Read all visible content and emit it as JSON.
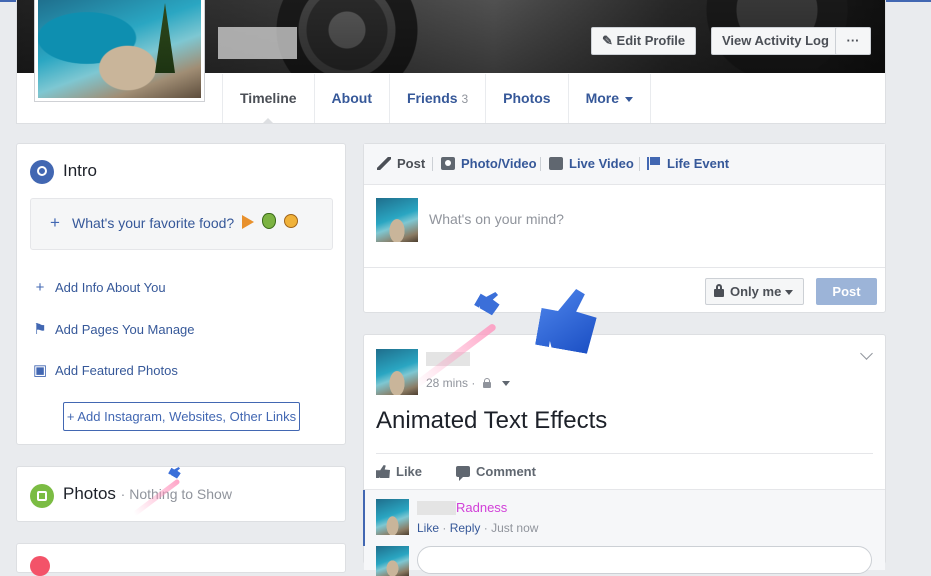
{
  "profile_header": {
    "buttons": {
      "edit_profile": "Edit Profile",
      "view_activity_log": "View Activity Log",
      "more": "···"
    },
    "tabs": [
      {
        "label": "Timeline"
      },
      {
        "label": "About"
      },
      {
        "label": "Friends",
        "count": "3"
      },
      {
        "label": "Photos"
      },
      {
        "label": "More"
      }
    ]
  },
  "intro": {
    "title": "Intro",
    "favorite_food_prompt": "What's your favorite food?",
    "links": [
      {
        "label": "Add Info About You",
        "icon": "plus-icon"
      },
      {
        "label": "Add Pages You Manage",
        "icon": "flag-icon"
      },
      {
        "label": "Add Featured Photos",
        "icon": "photo-add-icon"
      }
    ],
    "links_button": "Add Instagram, Websites, Other Links"
  },
  "photos_card": {
    "title": "Photos",
    "subtitle": "· Nothing to Show"
  },
  "composer": {
    "tabs": [
      {
        "label": "Post",
        "icon": "pencil-icon"
      },
      {
        "label": "Photo/Video",
        "icon": "camera-icon"
      },
      {
        "label": "Live Video",
        "icon": "video-camera-icon"
      },
      {
        "label": "Life Event",
        "icon": "flag-icon"
      }
    ],
    "placeholder": "What's on your mind?",
    "audience": "Only me",
    "post_button": "Post"
  },
  "feed_post": {
    "timestamp": "28 mins ·",
    "text": "Animated Text Effects",
    "actions": {
      "like": "Like",
      "comment": "Comment"
    },
    "comment": {
      "author_suffix": "Radness",
      "like": "Like",
      "reply": "Reply",
      "time": "Just now",
      "sep": "·"
    }
  },
  "colors": {
    "brand": "#4267b2",
    "link": "#365899",
    "comment_name": "#d13fd8"
  }
}
